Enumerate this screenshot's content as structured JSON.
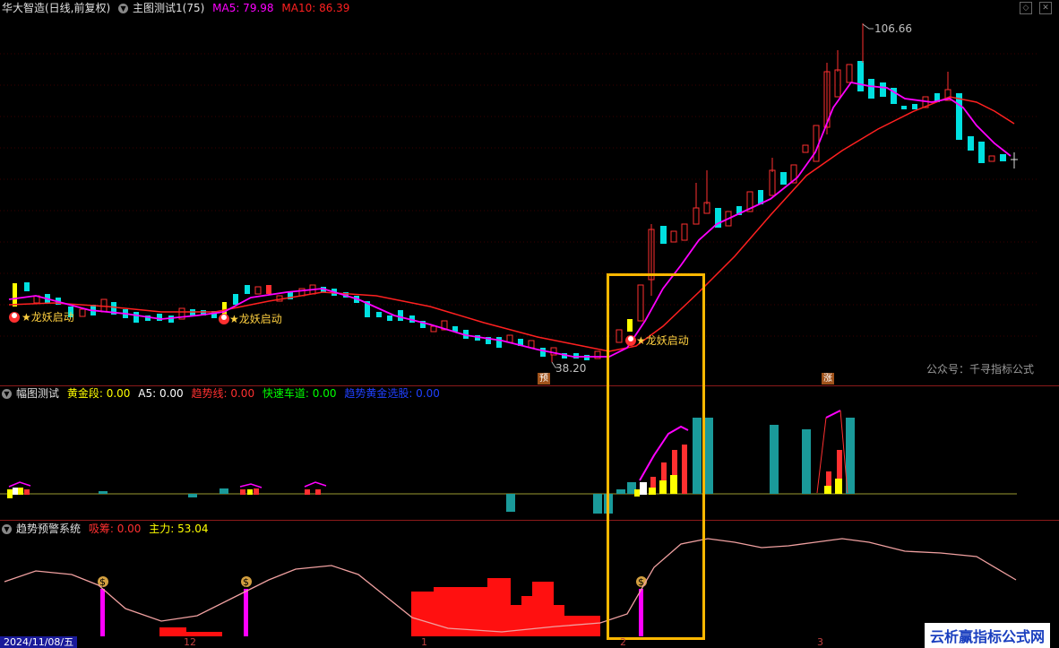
{
  "main": {
    "stock_name": "华大智造(日线,前复权)",
    "indicator_label": "主图测试1(75)",
    "ma5_label": "MA5: 79.98",
    "ma10_label": "MA10: 86.39",
    "high_label": "106.66",
    "low_label": "38.20",
    "signal_label": "★龙妖启动",
    "tag_yu": "预",
    "tag_zhang": "涨",
    "watermark": "公众号：千寻指标公式"
  },
  "panel2": {
    "title": "幅图测试",
    "items": [
      {
        "label": "黄金段: 0.00",
        "color": "#ffff00"
      },
      {
        "label": "A5: 0.00",
        "color": "#ffffff"
      },
      {
        "label": "趋势线: 0.00",
        "color": "#ff3030"
      },
      {
        "label": "快速车道: 0.00",
        "color": "#00ff00"
      },
      {
        "label": "趋势黄金选股: 0.00",
        "color": "#2040ff"
      }
    ]
  },
  "panel3": {
    "title": "趋势预警系统",
    "items": [
      {
        "label": "吸筹: 0.00",
        "color": "#ff3030"
      },
      {
        "label": "主力: 53.04",
        "color": "#ffff00"
      }
    ]
  },
  "axis": {
    "date": "2024/11/08/五",
    "months": [
      "12",
      "1",
      "2",
      "3"
    ]
  },
  "brand": "云析赢指标公式网",
  "colors": {
    "ma5": "#ff00ff",
    "ma10": "#ff2020",
    "up": "#ff3030",
    "down": "#00e0e0",
    "highlight": "#ffb800"
  }
}
